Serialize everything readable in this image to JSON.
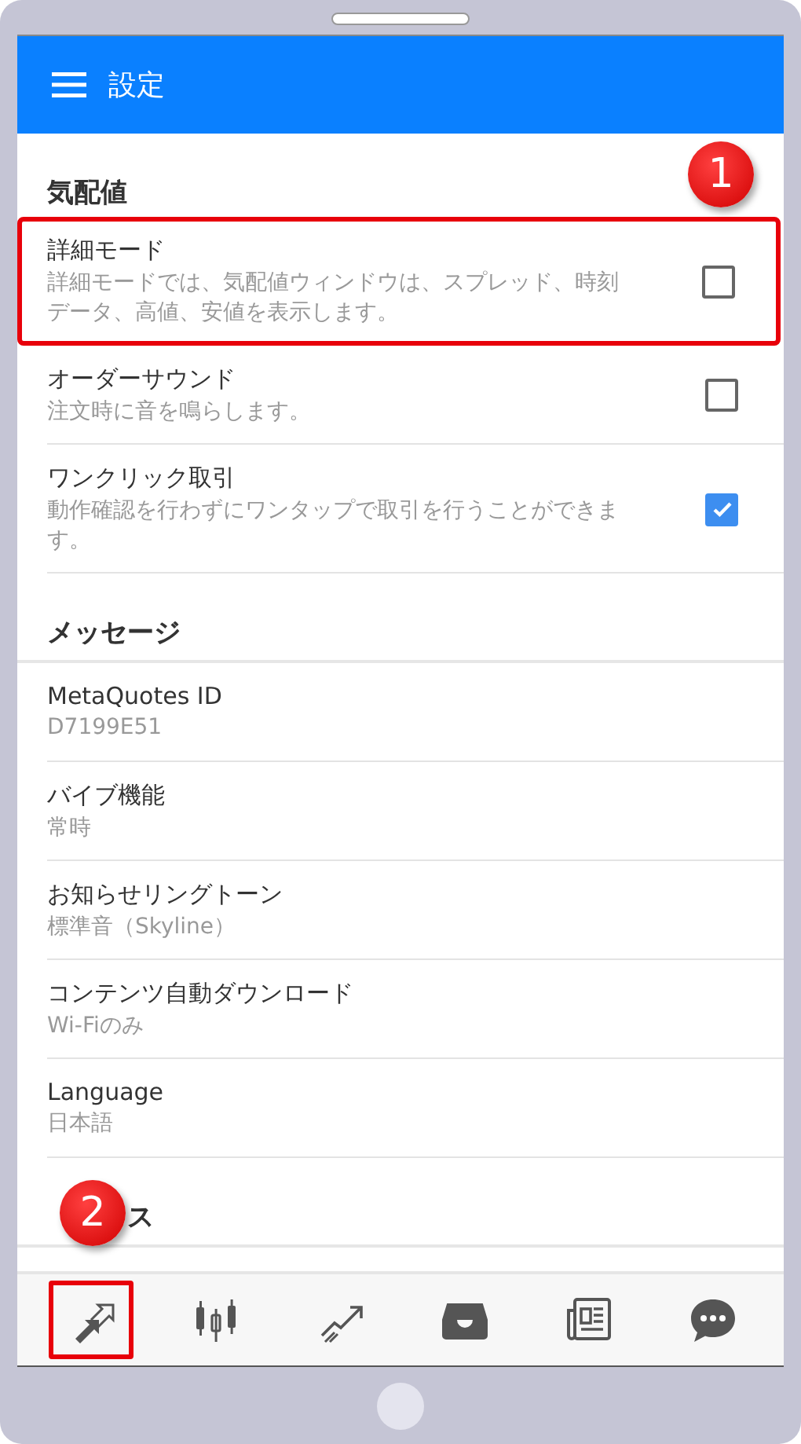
{
  "app_bar": {
    "title": "設定"
  },
  "sections": [
    {
      "title": "気配値",
      "items": [
        {
          "kind": "checkbox",
          "title": "詳細モード",
          "subtitle": "詳細モードでは、気配値ウィンドウは、スプレッド、時刻データ、高値、安値を表示します。",
          "checked": false,
          "highlighted": true,
          "badge": "1"
        },
        {
          "kind": "checkbox",
          "title": "オーダーサウンド",
          "subtitle": "注文時に音を鳴らします。",
          "checked": false,
          "highlighted": false
        },
        {
          "kind": "checkbox",
          "title": "ワンクリック取引",
          "subtitle": "動作確認を行わずにワンタップで取引を行うことができます。",
          "checked": true,
          "highlighted": false
        }
      ]
    },
    {
      "title": "メッセージ",
      "items": [
        {
          "kind": "value",
          "title": "MetaQuotes ID",
          "subtitle": "D7199E51"
        },
        {
          "kind": "value",
          "title": "バイブ機能",
          "subtitle": "常時"
        },
        {
          "kind": "value",
          "title": "お知らせリングトーン",
          "subtitle": "標準音（Skyline）"
        },
        {
          "kind": "value",
          "title": "コンテンツ自動ダウンロード",
          "subtitle": "Wi-Fiのみ"
        },
        {
          "kind": "value",
          "title": "Language",
          "subtitle": "日本語"
        }
      ]
    },
    {
      "title": "ス",
      "badge": "2"
    }
  ],
  "bottom_nav": [
    {
      "highlighted": true
    },
    {
      "highlighted": false
    },
    {
      "highlighted": false
    },
    {
      "highlighted": false
    },
    {
      "highlighted": false
    },
    {
      "highlighted": false
    }
  ]
}
